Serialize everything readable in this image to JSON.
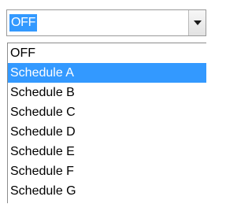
{
  "combo": {
    "value": "OFF",
    "button_icon": "chevron-down-icon"
  },
  "dropdown": {
    "selected_index": 1,
    "options": [
      "OFF",
      "Schedule A",
      "Schedule B",
      "Schedule C",
      "Schedule D",
      "Schedule E",
      "Schedule F",
      "Schedule G"
    ]
  },
  "colors": {
    "selection": "#3399ff",
    "selection_text": "#ffffff"
  }
}
